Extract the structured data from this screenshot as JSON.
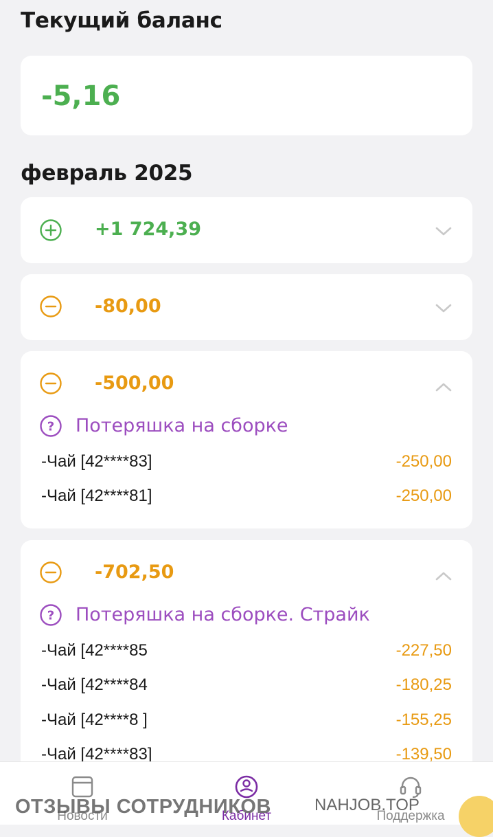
{
  "balance": {
    "title": "Текущий баланс",
    "value": "-5,16"
  },
  "period": {
    "label": "февраль 2025"
  },
  "operations": [
    {
      "type": "plus",
      "amount": "+1 724,39",
      "expanded": false
    },
    {
      "type": "minus",
      "amount": "-80,00",
      "expanded": false
    },
    {
      "type": "minus",
      "amount": "-500,00",
      "expanded": true,
      "reason": "Потеряшка на сборке",
      "items": [
        {
          "name": "-Чай [42****83]",
          "amount": "-250,00"
        },
        {
          "name": "-Чай [42****81]",
          "amount": "-250,00"
        }
      ]
    },
    {
      "type": "minus",
      "amount": "-702,50",
      "expanded": true,
      "reason": "Потеряшка на сборке. Страйк",
      "items": [
        {
          "name": "-Чай [42****85",
          "amount": "-227,50"
        },
        {
          "name": "-Чай [42****84",
          "amount": "-180,25"
        },
        {
          "name": "-Чай [42****8 ]",
          "amount": "-155,25"
        },
        {
          "name": "-Чай [42****83]",
          "amount": "-139,50"
        }
      ]
    }
  ],
  "tabbar": {
    "tabs": [
      {
        "label": "Новости",
        "icon": "news-icon",
        "active": false
      },
      {
        "label": "Кабинет",
        "icon": "profile-icon",
        "active": true
      },
      {
        "label": "Поддержка",
        "icon": "headset-icon",
        "active": false
      }
    ]
  },
  "watermark": {
    "left": "ОТЗЫВЫ СОТРУДНИКОВ",
    "right": "NAHJOB.TOP"
  },
  "colors": {
    "positive": "#4caf50",
    "negative": "#e89a12",
    "reason": "#9c4dbf",
    "tab_active": "#7b2ca4",
    "tab_inactive": "#8a8a8a"
  }
}
